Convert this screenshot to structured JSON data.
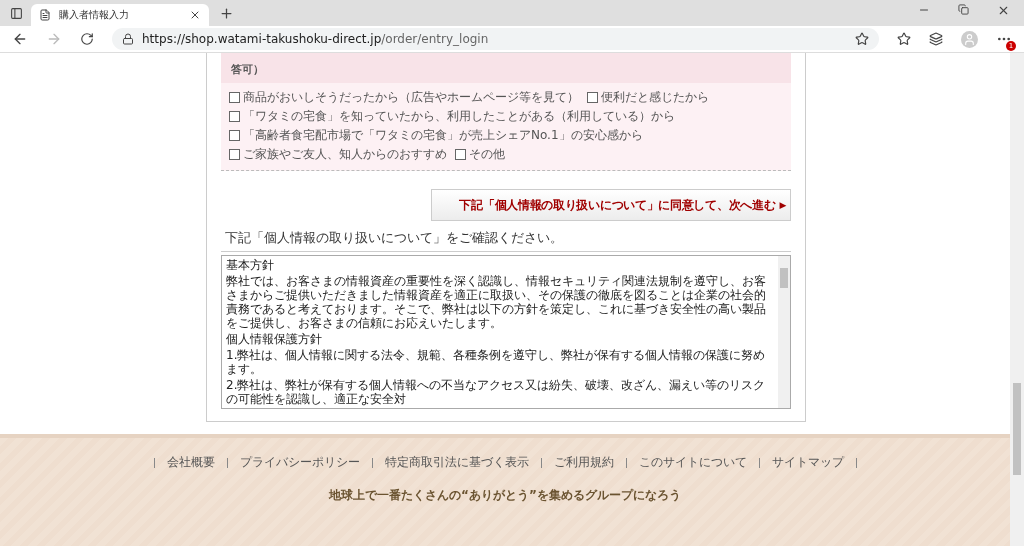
{
  "browser": {
    "tab_title": "購入者情報入力",
    "url_host": "https://shop.watami-takushoku-direct.jp",
    "url_path": "/order/entry_login",
    "notification_count": "1"
  },
  "survey": {
    "question_tail": "答可）",
    "options": [
      {
        "label": "商品がおいしそうだったから（広告やホームページ等を見て）",
        "checked": false
      },
      {
        "label": "便利だと感じたから",
        "checked": false
      },
      {
        "label": "「ワタミの宅食」を知っていたから、利用したことがある（利用している）から",
        "checked": false
      },
      {
        "label": "「高齢者食宅配市場で「ワタミの宅食」が売上シェアNo.1」の安心感から",
        "checked": false
      },
      {
        "label": "ご家族やご友人、知人からのおすすめ",
        "checked": false
      },
      {
        "label": "その他",
        "checked": false
      }
    ]
  },
  "agree_button": {
    "label": "下記「個人情報の取り扱いについて」に同意して、次へ進む",
    "arrow": "▶"
  },
  "privacy": {
    "heading": "下記「個人情報の取り扱いについて」をご確認ください。",
    "paragraphs": [
      "基本方針",
      "弊社では、お客さまの情報資産の重要性を深く認識し、情報セキュリティ関連法規制を遵守し、お客さまからご提供いただきました情報資産を適正に取扱い、その保護の徹底を図ることは企業の社会的責務であると考えております。そこで、弊社は以下の方針を策定し、これに基づき安全性の高い製品をご提供し、お客さまの信頼にお応えいたします。",
      "個人情報保護方針",
      "1.弊社は、個人情報に関する法令、規範、各種条例を遵守し、弊社が保有する個人情報の保護に努めます。",
      "2.弊社は、弊社が保有する個人情報への不当なアクセス又は紛失、破壊、改ざん、漏えい等のリスクの可能性を認識し、適正な安全対"
    ]
  },
  "footer": {
    "links": [
      "会社概要",
      "プライバシーポリシー",
      "特定商取引法に基づく表示",
      "ご利用規約",
      "このサイトについて",
      "サイトマップ"
    ],
    "tagline": "地球上で一番たくさんの“ありがとう”を集めるグループになろう"
  }
}
